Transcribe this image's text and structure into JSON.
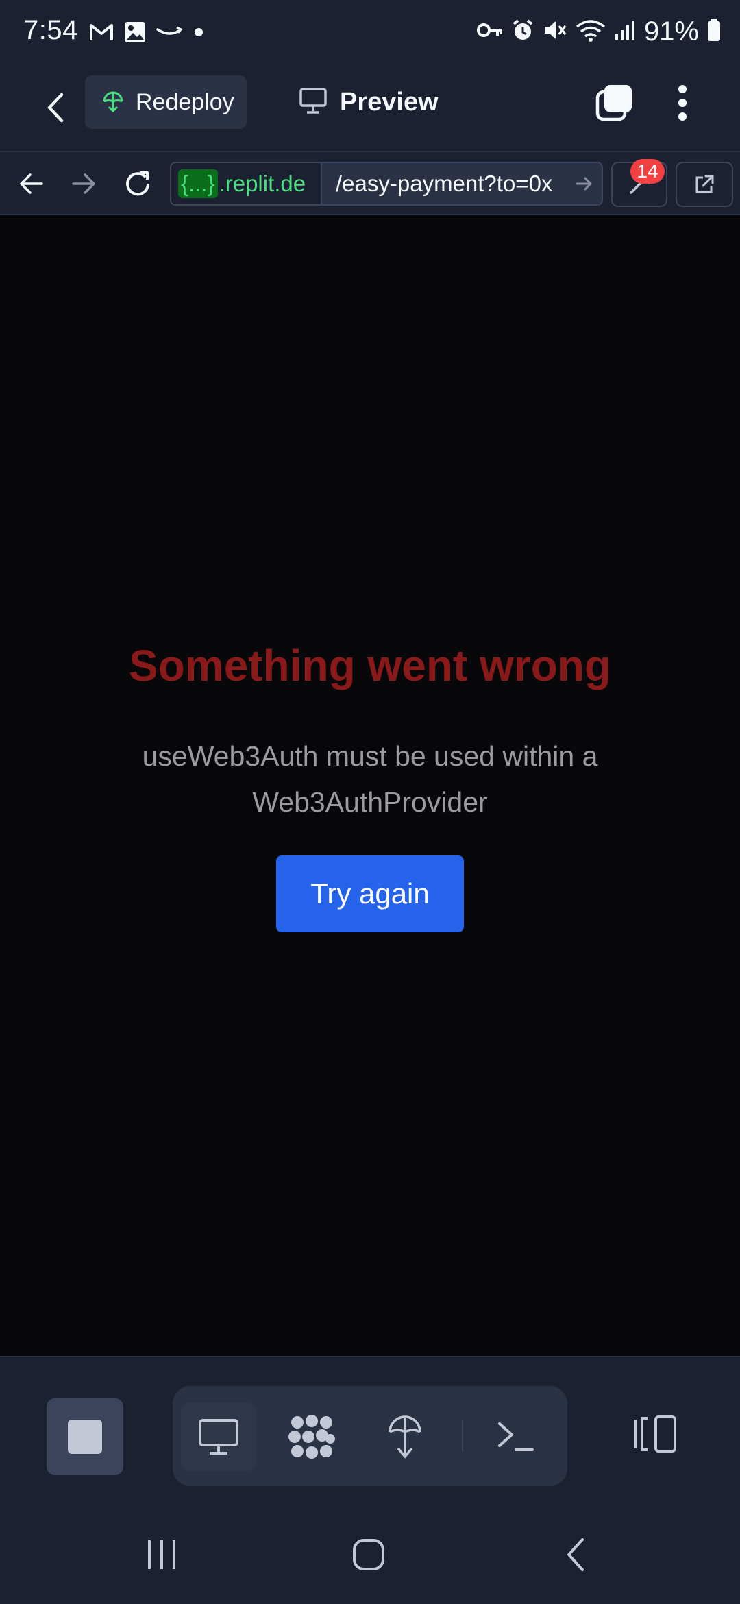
{
  "status_bar": {
    "time": "7:54",
    "battery": "91%",
    "left_icons": [
      "gmail-icon",
      "gallery-icon",
      "amazon-icon",
      "dot-icon"
    ],
    "right_icons": [
      "vpn-key-icon",
      "alarm-icon",
      "mute-icon",
      "wifi-icon",
      "signal-icon",
      "battery-icon"
    ]
  },
  "app_bar": {
    "redeploy_label": "Redeploy",
    "preview_label": "Preview"
  },
  "browser": {
    "url_badge": "{...}",
    "url_domain": ".replit.de",
    "url_path": "/easy-payment?to=0x",
    "devtools_count": "14"
  },
  "error": {
    "title": "Something went wrong",
    "message": "useWeb3Auth must be used within a Web3AuthProvider",
    "button_label": "Try again"
  },
  "colors": {
    "accent": "#2563eb",
    "error_title": "#8a1a1a",
    "deploy_green": "#4ade80",
    "badge_red": "#f23f42",
    "background": "#08080a",
    "chrome": "#1c2132"
  }
}
